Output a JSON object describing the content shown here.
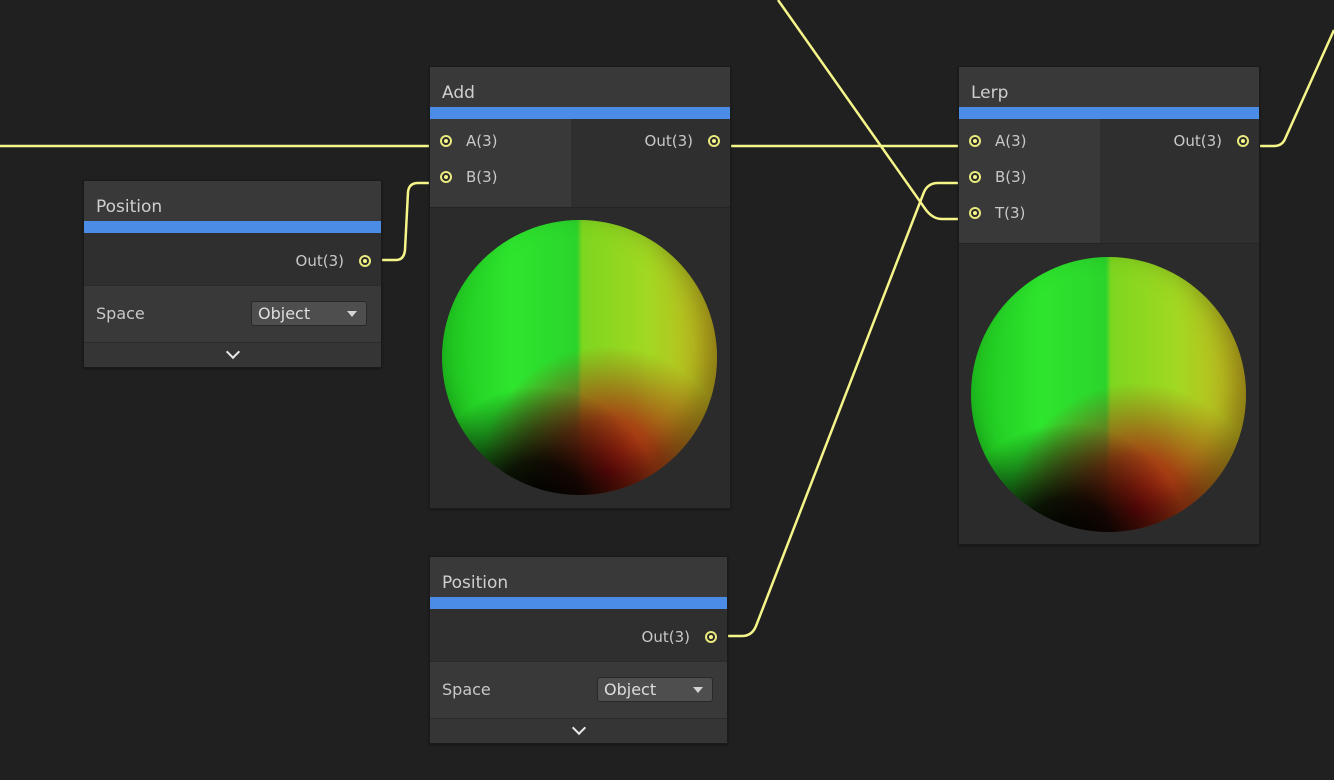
{
  "colors": {
    "background": "#202020",
    "node_body": "#393939",
    "node_accent": "#4a8ce6",
    "wire": "#f5f58a"
  },
  "nodes": {
    "position_left": {
      "title": "Position",
      "output_label": "Out(3)",
      "property_label": "Space",
      "dropdown_value": "Object"
    },
    "add": {
      "title": "Add",
      "inputs": [
        "A(3)",
        "B(3)"
      ],
      "output_label": "Out(3)"
    },
    "lerp": {
      "title": "Lerp",
      "inputs": [
        "A(3)",
        "B(3)",
        "T(3)"
      ],
      "output_label": "Out(3)"
    },
    "position_bottom": {
      "title": "Position",
      "output_label": "Out(3)",
      "property_label": "Space",
      "dropdown_value": "Object"
    }
  },
  "icons": {
    "port": "port-dot-icon",
    "dropdown": "chevron-down-icon",
    "expand": "expand-chevron-icon"
  }
}
